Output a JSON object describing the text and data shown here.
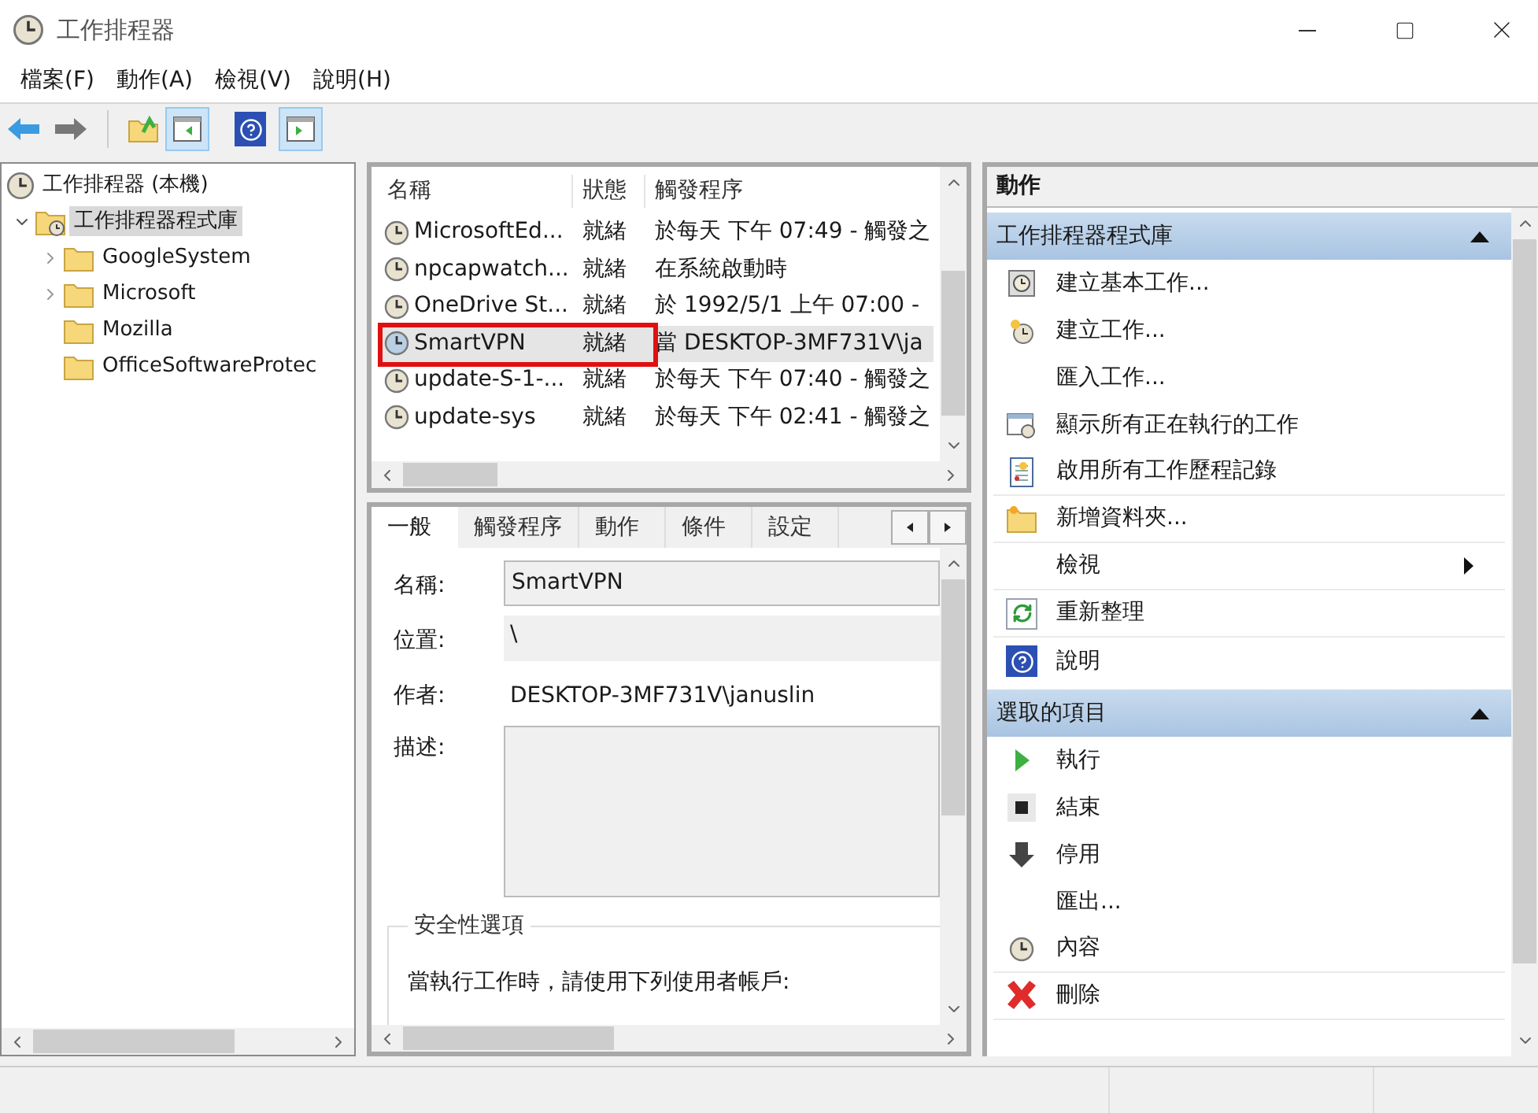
{
  "window": {
    "title": "工作排程器"
  },
  "menu": [
    "檔案(F)",
    "動作(A)",
    "檢視(V)",
    "說明(H)"
  ],
  "toolbar_toggles": [
    {
      "pressed": true
    },
    {
      "pressed": true
    }
  ],
  "tree": [
    {
      "label": "工作排程器 (本機)",
      "kind": "computer",
      "expandable": false,
      "selected": false,
      "children": [
        {
          "label": "工作排程器程式庫",
          "kind": "library",
          "expandable": true,
          "expanded": true,
          "selected": true,
          "children": [
            {
              "label": "GoogleSystem",
              "kind": "folder",
              "expandable": true,
              "expanded": false,
              "selected": false
            },
            {
              "label": "Microsoft",
              "kind": "folder",
              "expandable": true,
              "expanded": false,
              "selected": false
            },
            {
              "label": "Mozilla",
              "kind": "folder",
              "expandable": false,
              "selected": false
            },
            {
              "label": "OfficeSoftwareProtec",
              "kind": "folder",
              "expandable": false,
              "selected": false
            }
          ]
        }
      ]
    }
  ],
  "task_list": {
    "columns": [
      "名稱",
      "狀態",
      "觸發程序"
    ],
    "rows": [
      {
        "name": "MicrosoftEd...",
        "status": "就緒",
        "trigger": "於每天 下午 07:49 - 觸發之",
        "selected": false,
        "outlined": false
      },
      {
        "name": "npcapwatch...",
        "status": "就緒",
        "trigger": "在系統啟動時",
        "selected": false,
        "outlined": false
      },
      {
        "name": "OneDrive St...",
        "status": "就緒",
        "trigger": "於 1992/5/1 上午 07:00 -",
        "selected": false,
        "outlined": false
      },
      {
        "name": "SmartVPN",
        "status": "就緒",
        "trigger": "當 DESKTOP-3MF731V\\ja",
        "selected": true,
        "outlined": true
      },
      {
        "name": "update-S-1-...",
        "status": "就緒",
        "trigger": "於每天 下午 07:40 - 觸發之",
        "selected": false,
        "outlined": false
      },
      {
        "name": "update-sys",
        "status": "就緒",
        "trigger": "於每天 下午 02:41 - 觸發之",
        "selected": false,
        "outlined": false
      }
    ]
  },
  "details": {
    "tabs": [
      {
        "label": "一般",
        "selected": true
      },
      {
        "label": "觸發程序",
        "selected": false
      },
      {
        "label": "動作",
        "selected": false
      },
      {
        "label": "條件",
        "selected": false
      },
      {
        "label": "設定",
        "selected": false
      }
    ],
    "fields": [
      {
        "label": "名稱:",
        "value": "SmartVPN",
        "kind": "input"
      },
      {
        "label": "位置:",
        "value": "\\",
        "kind": "readonly"
      },
      {
        "label": "作者:",
        "value": "DESKTOP-3MF731V\\januslin",
        "kind": "text"
      },
      {
        "label": "描述:",
        "kind": "textarea"
      }
    ],
    "security": {
      "title": "安全性選項",
      "text": "當執行工作時，請使用下列使用者帳戶:"
    }
  },
  "actions": {
    "title": "動作",
    "sections": [
      {
        "title": "工作排程器程式庫",
        "expanded": true,
        "items": [
          {
            "label": "建立基本工作...",
            "kind": "basic-task",
            "submenu": false,
            "divider_after": false
          },
          {
            "label": "建立工作...",
            "kind": "new-task",
            "submenu": false,
            "divider_after": false
          },
          {
            "label": "匯入工作...",
            "kind": "import",
            "submenu": false,
            "divider_after": false
          },
          {
            "label": "顯示所有正在執行的工作",
            "kind": "running",
            "submenu": false,
            "divider_after": false
          },
          {
            "label": "啟用所有工作歷程記錄",
            "kind": "history",
            "submenu": false,
            "divider_after": true
          },
          {
            "label": "新增資料夾...",
            "kind": "folder",
            "submenu": false,
            "divider_after": true
          },
          {
            "label": "檢視",
            "kind": "view",
            "submenu": true,
            "divider_after": true
          },
          {
            "label": "重新整理",
            "kind": "refresh",
            "submenu": false,
            "divider_after": true
          },
          {
            "label": "說明",
            "kind": "help",
            "submenu": false,
            "divider_after": false
          }
        ]
      },
      {
        "title": "選取的項目",
        "expanded": true,
        "items": [
          {
            "label": "執行",
            "kind": "run",
            "submenu": false,
            "divider_after": false
          },
          {
            "label": "結束",
            "kind": "end",
            "submenu": false,
            "divider_after": false
          },
          {
            "label": "停用",
            "kind": "disable",
            "submenu": false,
            "divider_after": false
          },
          {
            "label": "匯出...",
            "kind": "export",
            "submenu": false,
            "divider_after": false
          },
          {
            "label": "內容",
            "kind": "properties",
            "submenu": false,
            "divider_after": true
          },
          {
            "label": "刪除",
            "kind": "delete",
            "submenu": false,
            "divider_after": true
          }
        ]
      }
    ]
  }
}
